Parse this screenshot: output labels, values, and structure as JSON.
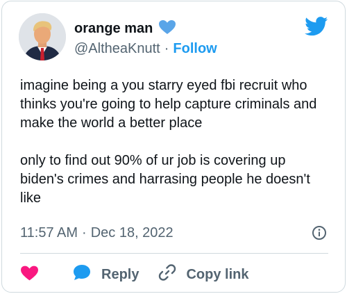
{
  "user": {
    "display_name": "orange man",
    "handle": "@AltheaKnutt",
    "separator": "·",
    "follow_label": "Follow"
  },
  "tweet": {
    "paragraphs": [
      "imagine being a you starry eyed fbi recruit who thinks you're going to help capture criminals and make the world a better place",
      "only to find out 90% of ur job is covering up biden's crimes and harrasing people he doesn't like"
    ],
    "time": "11:57 AM",
    "separator": "·",
    "date": "Dec 18, 2022"
  },
  "actions": {
    "reply_label": "Reply",
    "copy_link_label": "Copy link"
  },
  "icons": {
    "verified": "heart-badge-icon",
    "brand": "twitter-bird-icon",
    "info": "info-icon",
    "like": "heart-icon",
    "reply": "speech-bubble-icon",
    "link": "link-icon"
  },
  "colors": {
    "accent": "#1d9bf0",
    "like": "#f91880",
    "muted": "#536471",
    "text": "#0f1419",
    "border": "#cfd9de"
  }
}
